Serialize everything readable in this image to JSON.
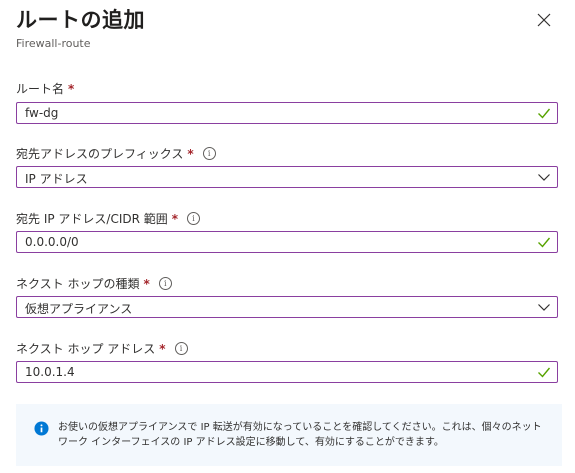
{
  "panel": {
    "title": "ルートの追加",
    "subtitle": "Firewall-route"
  },
  "fields": {
    "route_name": {
      "label": "ルート名",
      "required": "*",
      "value": "fw-dg"
    },
    "address_prefix_type": {
      "label": "宛先アドレスのプレフィックス",
      "required": "*",
      "value": "IP アドレス"
    },
    "dest_ip": {
      "label": "宛先 IP アドレス/CIDR 範囲",
      "required": "*",
      "value": "0.0.0.0/0"
    },
    "next_hop_type": {
      "label": "ネクスト ホップの種類",
      "required": "*",
      "value": "仮想アプライアンス"
    },
    "next_hop_address": {
      "label": "ネクスト ホップ アドレス",
      "required": "*",
      "value": "10.0.1.4"
    }
  },
  "info_banner": {
    "text": "お使いの仮想アプライアンスで IP 転送が有効になっていることを確認してください。これは、個々のネットワーク インターフェイスの IP アドレス設定に移動して、有効にすることができます。"
  },
  "icons": {
    "info_glyph": "i"
  },
  "colors": {
    "input_border": "#8a3fa0",
    "check": "#57a300",
    "required": "#a4262c",
    "info_blue": "#0078d4",
    "banner_bg": "#f3f8fd"
  }
}
